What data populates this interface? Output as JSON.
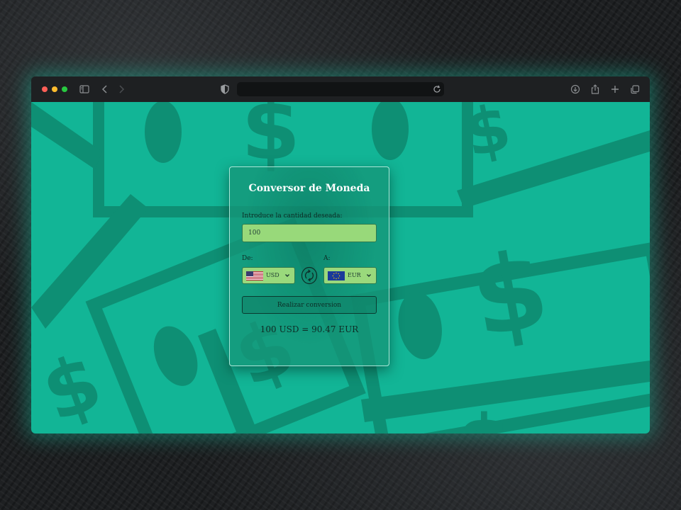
{
  "converter": {
    "title": "Conversor de Moneda",
    "amount_label": "Introduce la cantidad deseada:",
    "amount_value": "100",
    "from_label": "De:",
    "to_label": "A:",
    "from_currency": "USD",
    "to_currency": "EUR",
    "convert_button": "Realizar conversion",
    "result": "100 USD = 90.47 EUR"
  },
  "icons": {
    "sidebar": "sidebar-icon",
    "back": "chevron-left-icon",
    "forward": "chevron-right-icon",
    "shield": "shield-icon",
    "reload": "reload-icon",
    "download": "download-icon",
    "share": "share-icon",
    "new_tab": "plus-icon",
    "tabs": "tabs-overview-icon",
    "swap": "swap-icon"
  },
  "colors": {
    "page_background": "#12b596",
    "bill_color": "#0e8f74",
    "card_background": "#14967a",
    "input_fill": "#98d97a",
    "window_glow": "#16bea0"
  }
}
